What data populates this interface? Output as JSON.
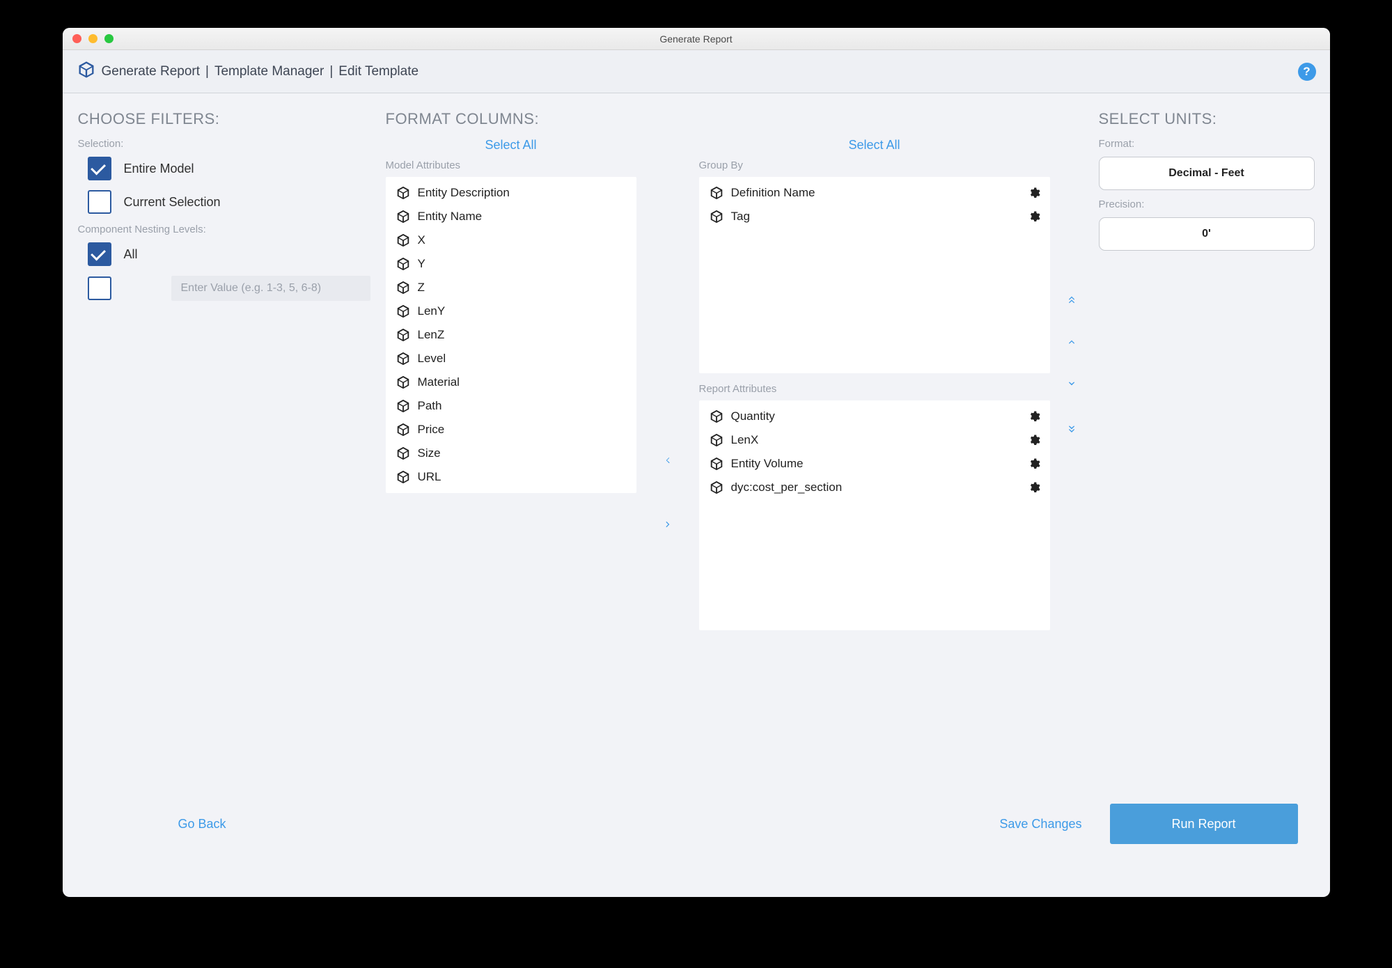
{
  "window": {
    "title": "Generate Report"
  },
  "breadcrumb": {
    "app": "Generate Report",
    "sep": " | ",
    "section": "Template Manager",
    "page": "Edit Template"
  },
  "filters": {
    "title": "CHOOSE FILTERS:",
    "selection_label": "Selection:",
    "entire_model": "Entire Model",
    "current_selection": "Current Selection",
    "nesting_label": "Component Nesting Levels:",
    "all": "All",
    "nesting_placeholder": "Enter Value (e.g. 1-3, 5, 6-8)"
  },
  "format": {
    "title": "FORMAT COLUMNS:",
    "select_all": "Select All",
    "model_attributes_label": "Model Attributes",
    "group_by_label": "Group By",
    "report_attributes_label": "Report Attributes",
    "model_attributes": [
      "Entity Description",
      "Entity Name",
      "X",
      "Y",
      "Z",
      "LenY",
      "LenZ",
      "Level",
      "Material",
      "Path",
      "Price",
      "Size",
      "URL"
    ],
    "group_by": [
      "Definition Name",
      "Tag"
    ],
    "report_attributes": [
      "Quantity",
      "LenX",
      "Entity Volume",
      "dyc:cost_per_section"
    ]
  },
  "units": {
    "title": "SELECT UNITS:",
    "format_label": "Format:",
    "format_value": "Decimal - Feet",
    "precision_label": "Precision:",
    "precision_value": "0'"
  },
  "footer": {
    "go_back": "Go Back",
    "save": "Save Changes",
    "run": "Run Report"
  }
}
